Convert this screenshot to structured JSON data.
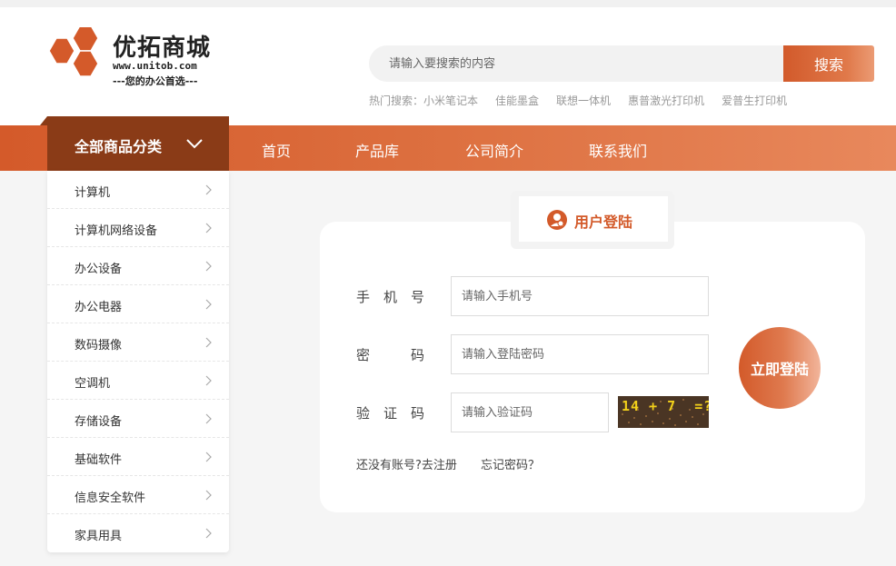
{
  "brand": {
    "name": "优拓商城",
    "url": "www.unitob.com",
    "slogan": "---您的办公首选---",
    "accent": "#d45a2a",
    "dark_accent": "#8a3b17"
  },
  "search": {
    "placeholder": "请输入要搜索的内容",
    "button_label": "搜索",
    "hot_label": "热门搜索：",
    "hot_terms": [
      "小米笔记本",
      "佳能墨盒",
      "联想一体机",
      "惠普激光打印机",
      "爱普生打印机"
    ]
  },
  "nav": {
    "category_label": "全部商品分类",
    "items": [
      "首页",
      "产品库",
      "公司简介",
      "联系我们"
    ]
  },
  "sidebar": {
    "items": [
      "计算机",
      "计算机网络设备",
      "办公设备",
      "办公电器",
      "数码摄像",
      "空调机",
      "存储设备",
      "基础软件",
      "信息安全软件",
      "家具用具"
    ]
  },
  "login": {
    "title": "用户登陆",
    "phone_label": "手　机　号",
    "phone_placeholder": "请输入手机号",
    "password_label": "密　　　码",
    "password_placeholder": "请输入登陆密码",
    "captcha_label": "验　证　码",
    "captcha_placeholder": "请输入验证码",
    "captcha_text": "14 + 7  =?",
    "submit_label": "立即登陆",
    "register_link": "还没有账号?去注册",
    "forgot_link": "忘记密码？"
  }
}
